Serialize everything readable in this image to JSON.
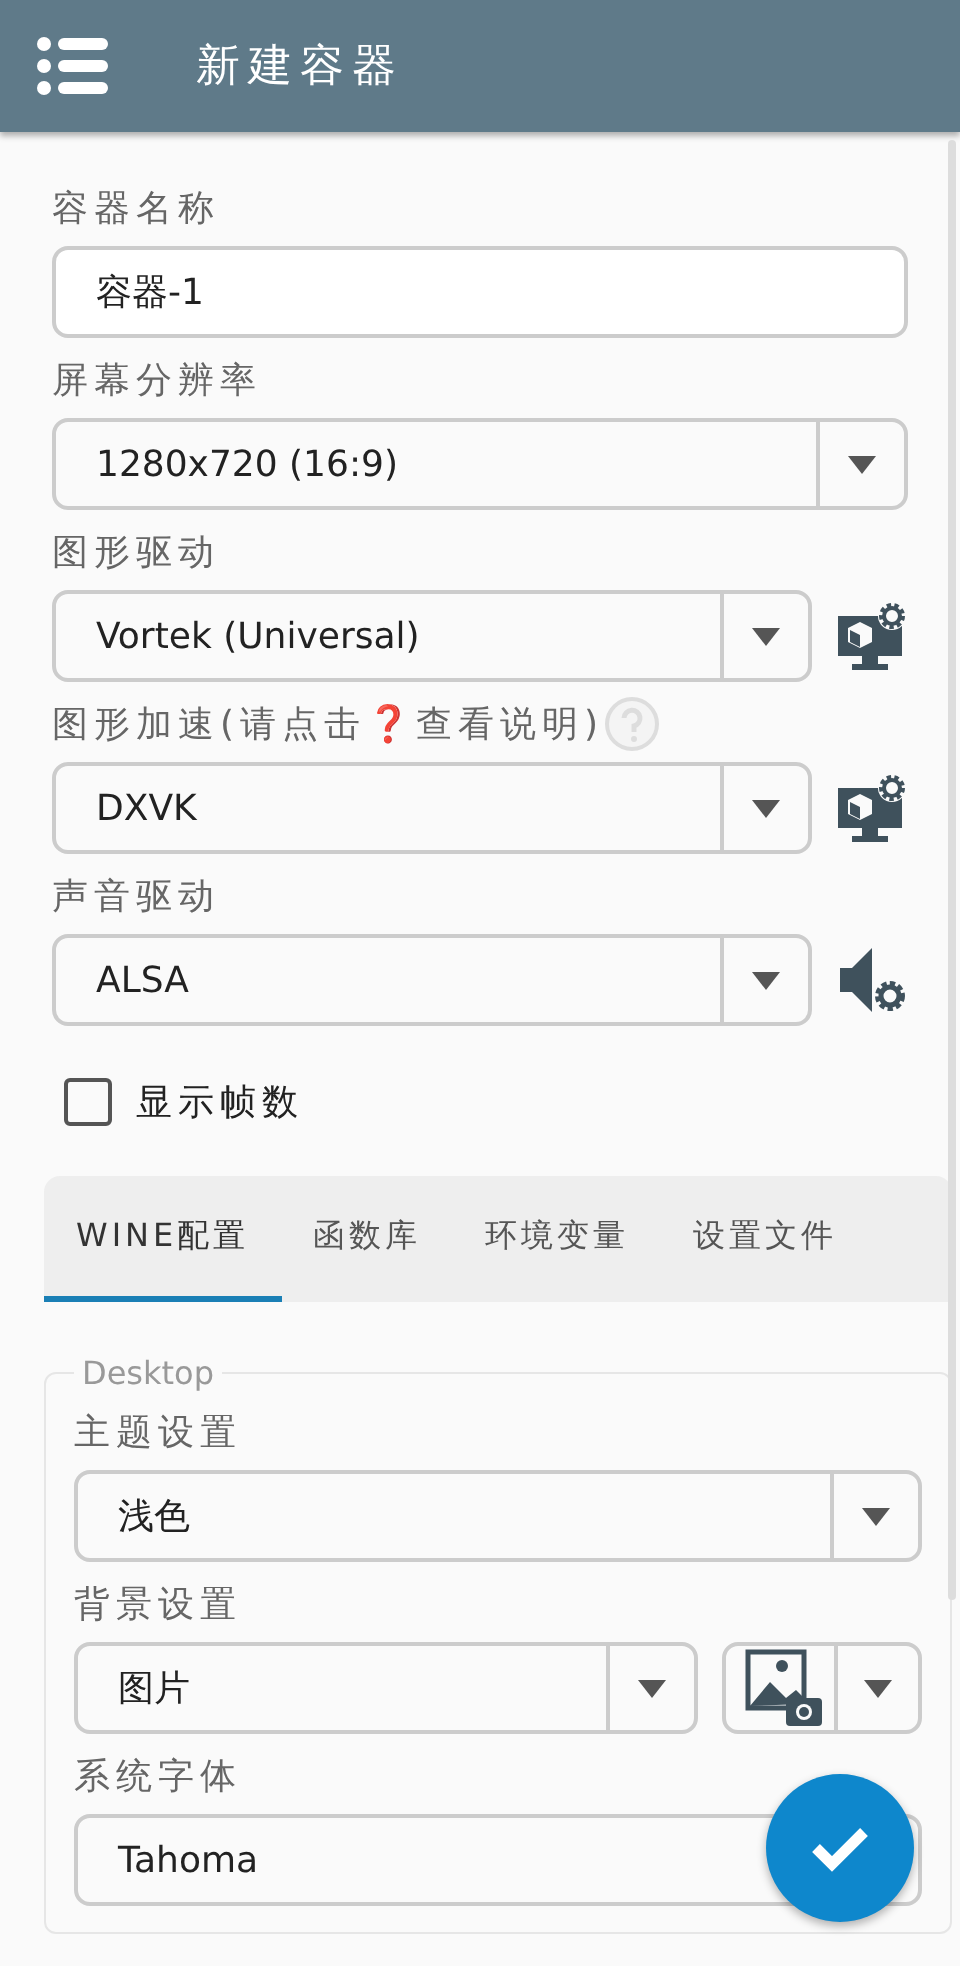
{
  "app_bar": {
    "title": "新建容器"
  },
  "fields": [
    {
      "kind": "text",
      "label": "容器名称",
      "value": "容器-1"
    },
    {
      "kind": "select",
      "label": "屏幕分辨率",
      "value": "1280x720 (16:9)"
    },
    {
      "kind": "select",
      "label": "图形驱动",
      "value": "Vortek (Universal)",
      "accessory": {
        "kind": "display-settings"
      }
    },
    {
      "kind": "select",
      "label": "图形加速(请点击❓查看说明)",
      "help": true,
      "value": "DXVK",
      "accessory": {
        "kind": "display-settings"
      }
    },
    {
      "kind": "select",
      "label": "声音驱动",
      "value": "ALSA",
      "accessory": {
        "kind": "audio-settings"
      }
    }
  ],
  "checkbox": {
    "label": "显示帧数",
    "checked": false
  },
  "tabs": [
    {
      "label": "WINE配置",
      "selected": true
    },
    {
      "label": "函数库",
      "selected": false
    },
    {
      "label": "环境变量",
      "selected": false
    },
    {
      "label": "设置文件",
      "selected": false
    }
  ],
  "desktop": {
    "legend": "Desktop",
    "fields": [
      {
        "kind": "select",
        "label": "主题设置",
        "value": "浅色"
      },
      {
        "kind": "select",
        "label": "背景设置",
        "value": "图片",
        "accessory": {
          "kind": "image-picker"
        }
      },
      {
        "kind": "select",
        "label": "系统字体",
        "value": "Tahoma"
      }
    ]
  }
}
